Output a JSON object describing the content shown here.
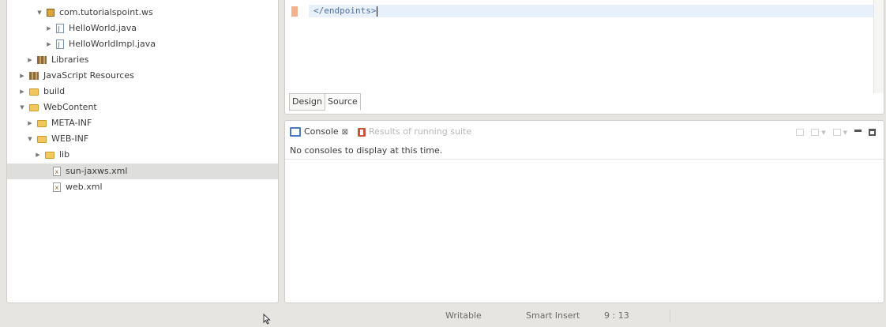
{
  "explorer": {
    "items": [
      {
        "label": "com.tutorialspoint.ws",
        "icon": "package-icon",
        "twisty": "▼"
      },
      {
        "label": "HelloWorld.java",
        "icon": "java-file-icon",
        "twisty": "▶"
      },
      {
        "label": "HelloWorldImpl.java",
        "icon": "java-file-icon",
        "twisty": "▶"
      },
      {
        "label": "Libraries",
        "icon": "library-icon",
        "twisty": "▶"
      },
      {
        "label": "JavaScript Resources",
        "icon": "library-icon",
        "twisty": "▶"
      },
      {
        "label": "build",
        "icon": "folder-icon",
        "twisty": "▶"
      },
      {
        "label": "WebContent",
        "icon": "folder-icon",
        "twisty": "▼"
      },
      {
        "label": "META-INF",
        "icon": "folder-icon",
        "twisty": "▶"
      },
      {
        "label": "WEB-INF",
        "icon": "folder-icon",
        "twisty": "▼"
      },
      {
        "label": "lib",
        "icon": "folder-icon",
        "twisty": "▶"
      },
      {
        "label": "sun-jaxws.xml",
        "icon": "xml-file-icon",
        "twisty": ""
      },
      {
        "label": "web.xml",
        "icon": "xml-file-icon",
        "twisty": ""
      }
    ],
    "selected_item": "sun-jaxws.xml"
  },
  "editor": {
    "code_line": "</endpoints>",
    "tabs": [
      "Design",
      "Source"
    ],
    "active_tab": "Source"
  },
  "console": {
    "tab_label": "Console",
    "tab_close": "⊠",
    "results_label": "Results of running suite",
    "message": "No consoles to display at this time."
  },
  "status": {
    "writable": "Writable",
    "insert_mode": "Smart Insert",
    "position": "9 : 13"
  },
  "colors": {
    "background": "#e6e5e2",
    "selection": "#dededc",
    "current_line": "#e8f0fb",
    "code_text": "#4e6fa0",
    "console_icon": "#4d79c1"
  }
}
